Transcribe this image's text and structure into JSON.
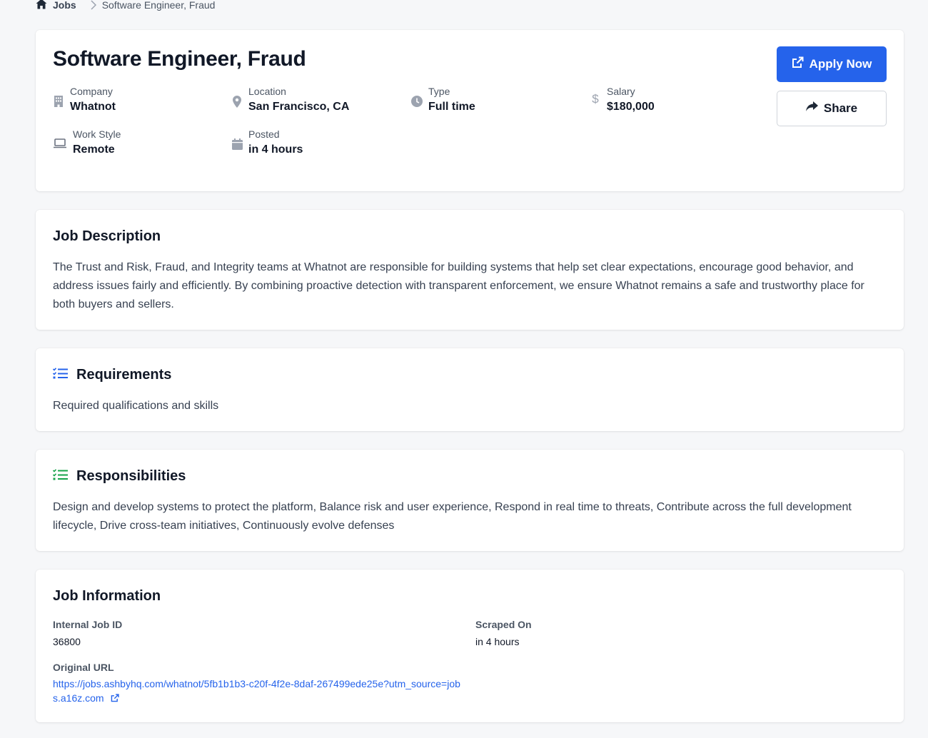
{
  "breadcrumb": {
    "home": "Jobs",
    "current": "Software Engineer, Fraud"
  },
  "job": {
    "title": "Software Engineer, Fraud",
    "company": {
      "label": "Company",
      "value": "Whatnot"
    },
    "location": {
      "label": "Location",
      "value": "San Francisco, CA"
    },
    "type": {
      "label": "Type",
      "value": "Full time"
    },
    "salary": {
      "label": "Salary",
      "value": "$180,000"
    },
    "work_style": {
      "label": "Work Style",
      "value": "Remote"
    },
    "posted": {
      "label": "Posted",
      "value": "in 4 hours"
    }
  },
  "actions": {
    "apply": "Apply Now",
    "share": "Share"
  },
  "description": {
    "title": "Job Description",
    "text": "The Trust and Risk, Fraud, and Integrity teams at Whatnot are responsible for building systems that help set clear expectations, encourage good behavior, and address issues fairly and efficiently. By combining proactive detection with transparent enforcement, we ensure Whatnot remains a safe and trustworthy place for both buyers and sellers."
  },
  "requirements": {
    "title": "Requirements",
    "text": "Required qualifications and skills"
  },
  "responsibilities": {
    "title": "Responsibilities",
    "text": "Design and develop systems to protect the platform, Balance risk and user experience, Respond in real time to threats, Contribute across the full development lifecycle, Drive cross-team initiatives, Continuously evolve defenses"
  },
  "info": {
    "title": "Job Information",
    "job_id_label": "Internal Job ID",
    "job_id": "36800",
    "scraped_label": "Scraped On",
    "scraped": "in 4 hours",
    "url_label": "Original URL",
    "url": "https://jobs.ashbyhq.com/whatnot/5fb1b1b3-c20f-4f2e-8daf-267499ede25e?utm_source=jobs.a16z.com"
  },
  "colors": {
    "primary": "#2563eb",
    "requirements_icon": "#2563eb",
    "responsibilities_icon": "#16a34a"
  },
  "icons": [
    "home-icon",
    "chevron-right-icon",
    "building-icon",
    "map-pin-icon",
    "clock-icon",
    "dollar-icon",
    "laptop-icon",
    "calendar-icon",
    "external-link-icon",
    "share-icon",
    "list-check-icon"
  ]
}
